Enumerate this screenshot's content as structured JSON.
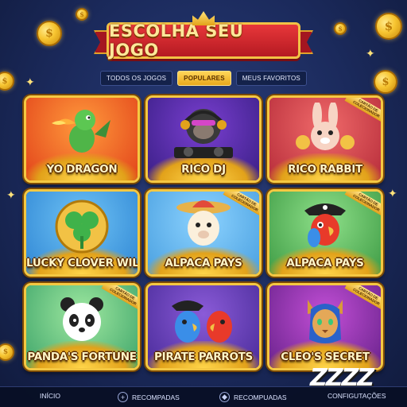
{
  "banner": {
    "title": "ESCOLHA SEU JOGO"
  },
  "tabs": [
    {
      "label": "TODOS OS JOGOS",
      "active": false
    },
    {
      "label": "POPULARES",
      "active": true
    },
    {
      "label": "MEUS FAVORITOS",
      "active": false
    }
  ],
  "badge_text": "CARTÃO DE COLECIONADOR",
  "games": [
    {
      "title": "YO DRAGON",
      "collector": false,
      "bg": [
        "#ff9a3c",
        "#e2431a"
      ],
      "icon": "dragon-icon"
    },
    {
      "title": "RICO DJ",
      "collector": false,
      "bg": [
        "#7a3fd0",
        "#3a1f86"
      ],
      "icon": "gorilla-dj-icon"
    },
    {
      "title": "RICO RABBIT",
      "collector": true,
      "bg": [
        "#f06a6a",
        "#b72d3a"
      ],
      "icon": "rabbit-icon"
    },
    {
      "title": "LUCKY CLOVER WILD",
      "collector": false,
      "bg": [
        "#6fc3f5",
        "#2f86d4"
      ],
      "icon": "clover-icon"
    },
    {
      "title": "ALPACA PAYS",
      "collector": true,
      "bg": [
        "#8dd3ff",
        "#4aa0e0"
      ],
      "icon": "alpaca-icon"
    },
    {
      "title": "ALPACA PAYS",
      "collector": true,
      "bg": [
        "#8fe08a",
        "#3f9c45"
      ],
      "icon": "pirate-parrot-icon"
    },
    {
      "title": "PANDA'S FORTUNE",
      "collector": true,
      "bg": [
        "#9fe8a0",
        "#3fa56a"
      ],
      "icon": "panda-icon"
    },
    {
      "title": "PIRATE PARROTS",
      "collector": false,
      "bg": [
        "#8b5bd8",
        "#4a2c9a"
      ],
      "icon": "parrots-icon"
    },
    {
      "title": "CLEO'S SECRET",
      "collector": true,
      "bg": [
        "#c24fd6",
        "#6a238c"
      ],
      "icon": "sphinx-cat-icon"
    }
  ],
  "watermark": "ZZZZ",
  "nav": [
    {
      "label": "INÍCIO",
      "icon": "home-icon"
    },
    {
      "label": "RECOMPADAS",
      "icon": "plus-circle-icon"
    },
    {
      "label": "RECOMPUADAS",
      "icon": "gift-icon"
    },
    {
      "label": "CONFIGUTAÇÕES",
      "icon": "gear-icon"
    }
  ]
}
